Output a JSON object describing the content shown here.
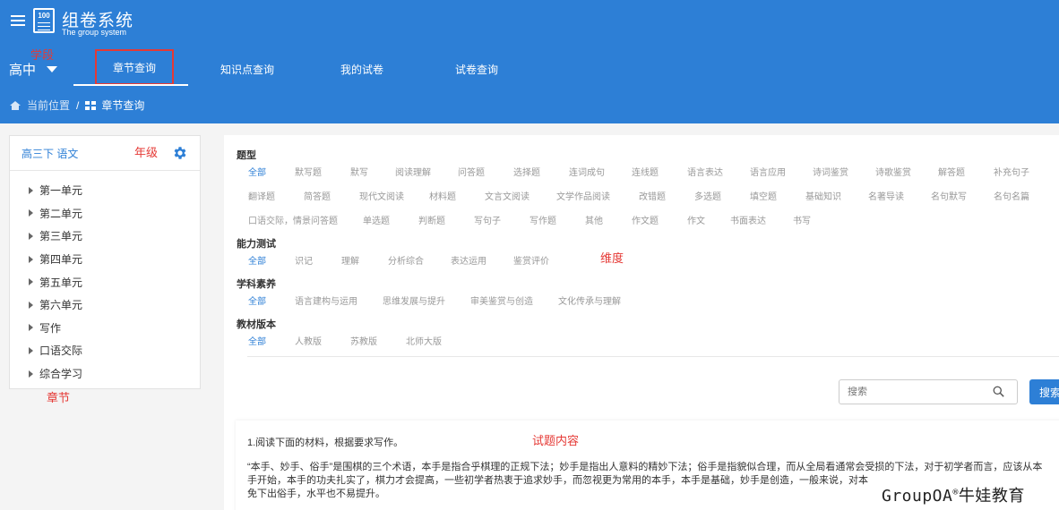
{
  "header": {
    "app_title": "组卷系统",
    "app_subtitle": "The group system",
    "logo_text": "100",
    "level_annotation": "学段",
    "level_value": "高中",
    "nav_tabs": [
      "章节查询",
      "知识点查询",
      "我的试卷",
      "试卷查询"
    ],
    "active_tab": "章节查询"
  },
  "breadcrumb": {
    "home_label": "当前位置",
    "separator": "/",
    "current": "章节查询"
  },
  "sidebar": {
    "grade_label": "高三下 语文",
    "grade_annotation": "年级",
    "chapter_annotation": "章节",
    "units": [
      "第一单元",
      "第二单元",
      "第三单元",
      "第四单元",
      "第五单元",
      "第六单元",
      "写作",
      "口语交际",
      "综合学习"
    ]
  },
  "filters": {
    "dimension_annotation": "维度",
    "groups": [
      {
        "title": "题型",
        "options": [
          "全部",
          "默写题",
          "默写",
          "阅读理解",
          "问答题",
          "选择题",
          "连词成句",
          "连线题",
          "语言表达",
          "语言应用",
          "诗词鉴赏",
          "诗歌鉴赏",
          "解答题",
          "补充句子",
          "翻译题",
          "简答题",
          "现代文阅读",
          "材料题",
          "文言文阅读",
          "文学作品阅读",
          "改错题",
          "多选题",
          "填空题",
          "基础知识",
          "名著导读",
          "名句默写",
          "名句名篇",
          "口语交际，情景问答题",
          "单选题",
          "判断题",
          "写句子",
          "写作题",
          "其他",
          "作文题",
          "作文",
          "书面表达",
          "书写"
        ]
      },
      {
        "title": "能力测试",
        "options": [
          "全部",
          "识记",
          "理解",
          "分析综合",
          "表达运用",
          "鉴赏评价"
        ]
      },
      {
        "title": "学科素养",
        "options": [
          "全部",
          "语言建构与运用",
          "思维发展与提升",
          "审美鉴赏与创造",
          "文化传承与理解"
        ]
      },
      {
        "title": "教材版本",
        "options": [
          "全部",
          "人教版",
          "苏教版",
          "北师大版"
        ]
      }
    ]
  },
  "search": {
    "placeholder": "搜索",
    "button_label": "搜索"
  },
  "question": {
    "content_annotation": "试题内容",
    "title": "1.阅读下面的材料，根据要求写作。",
    "body_lines": [
      "“本手、妙手、俗手”是围棋的三个术语，本手是指合乎棋理的正规下法；妙手是指出人意料的精妙下法；俗手是指貌似合理，而从全局看通常会受损的下法，对于初学者而言，应该从本",
      "手开始，本手的功夫扎实了，棋力才会提高，一些初学者热衷于追求妙手，而忽视更为常用的本手，本手是基础，妙手是创造，一般来说，对本",
      "免下出俗手，水平也不易提升。"
    ]
  },
  "watermark": {
    "brand": "GroupOA",
    "mark": "®",
    "suffix": "牛娃教育"
  },
  "colors": {
    "primary": "#2d7fd6",
    "annotation": "#e53935",
    "muted_text": "#999999"
  }
}
